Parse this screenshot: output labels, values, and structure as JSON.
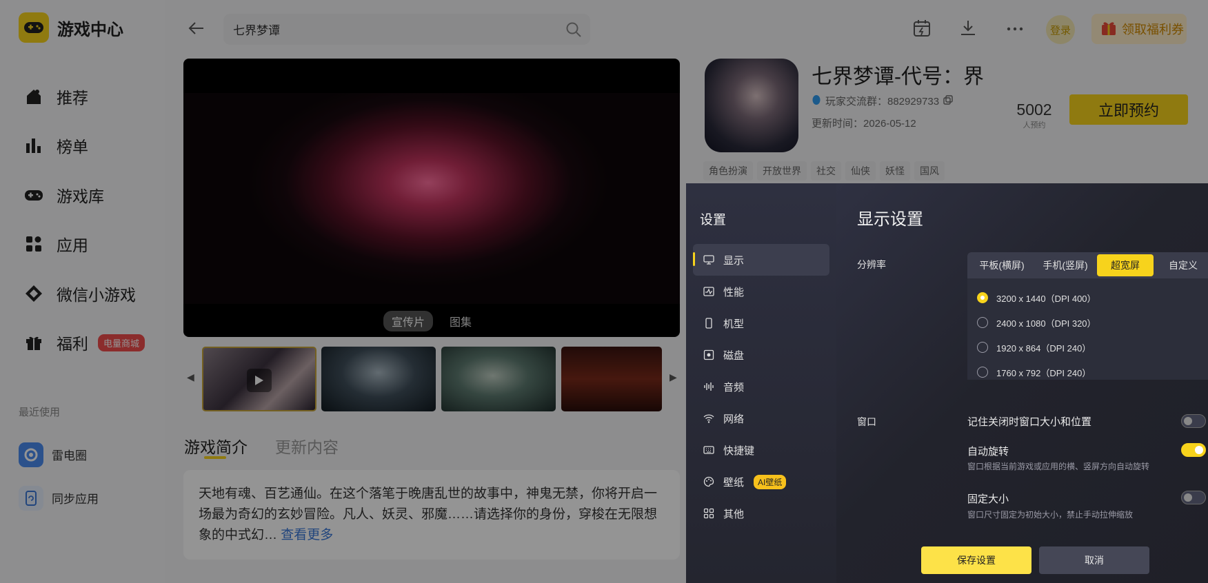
{
  "app": {
    "name": "游戏中心",
    "colors": {
      "accent": "#f7d31c",
      "panel_bg": "#24252f",
      "red_badge": "#f04d4d",
      "link": "#3a78d8"
    }
  },
  "sidebar": {
    "items": [
      {
        "label": "推荐",
        "icon": "house-icon"
      },
      {
        "label": "榜单",
        "icon": "bar-chart-icon"
      },
      {
        "label": "游戏库",
        "icon": "gamepad-icon"
      },
      {
        "label": "应用",
        "icon": "apps-icon"
      },
      {
        "label": "微信小游戏",
        "icon": "diamond-icon"
      },
      {
        "label": "福利",
        "icon": "gift-icon",
        "badge": "电量商城"
      }
    ],
    "recent_title": "最近使用",
    "recent": [
      {
        "label": "雷电圈",
        "icon": "circle-app-icon"
      },
      {
        "label": "同步应用",
        "icon": "sync-app-icon"
      }
    ]
  },
  "topbar": {
    "search_value": "七界梦谭",
    "login": "登录",
    "welfare": "领取福利券"
  },
  "media": {
    "tabs": [
      "宣传片",
      "图集"
    ],
    "active_tab": 0
  },
  "content_tabs": [
    "游戏简介",
    "更新内容"
  ],
  "intro": {
    "text": "天地有魂、百艺通仙。在这个落笔于晚唐乱世的故事中，神鬼无禁，你将开启一场最为奇幻的玄妙冒险。凡人、妖灵、邪魔……请选择你的身份，穿梭在无限想象的中式幻…",
    "more": "查看更多"
  },
  "game": {
    "title": "七界梦谭-代号：界",
    "qq_group": "玩家交流群：882929733",
    "update": "更新时间：2026-05-12",
    "reservations": "5002",
    "reservations_label": "人预约",
    "reserve_button": "立即预约",
    "tags": [
      "角色扮演",
      "开放世界",
      "社交",
      "仙侠",
      "妖怪",
      "国风"
    ]
  },
  "settings": {
    "title": "设置",
    "menu": [
      {
        "label": "显示",
        "icon": "monitor-icon"
      },
      {
        "label": "性能",
        "icon": "performance-icon"
      },
      {
        "label": "机型",
        "icon": "phone-icon"
      },
      {
        "label": "磁盘",
        "icon": "disk-icon"
      },
      {
        "label": "音频",
        "icon": "audio-icon"
      },
      {
        "label": "网络",
        "icon": "wifi-icon"
      },
      {
        "label": "快捷键",
        "icon": "keyboard-icon"
      },
      {
        "label": "壁纸",
        "icon": "palette-icon",
        "badge": "AI壁纸"
      },
      {
        "label": "其他",
        "icon": "grid-icon"
      }
    ],
    "active_menu": 0,
    "display_title": "显示设置",
    "resolution_label": "分辨率",
    "resolution_tabs": [
      "平板(横屏)",
      "手机(竖屏)",
      "超宽屏",
      "自定义"
    ],
    "active_resolution_tab": 2,
    "resolutions": [
      {
        "label": "3200 x 1440（DPI 400）",
        "selected": true
      },
      {
        "label": "2400 x 1080（DPI 320）",
        "selected": false
      },
      {
        "label": "1920 x 864（DPI 240）",
        "selected": false
      },
      {
        "label": "1760 x 792（DPI 240）",
        "selected": false
      }
    ],
    "window_label": "窗口",
    "window_options": [
      {
        "title": "记住关闭时窗口大小和位置",
        "desc": "",
        "on": false
      },
      {
        "title": "自动旋转",
        "desc": "窗口根据当前游戏或应用的横、竖屏方向自动旋转",
        "on": true
      },
      {
        "title": "固定大小",
        "desc": "窗口尺寸固定为初始大小，禁止手动拉伸缩放",
        "on": false
      }
    ],
    "save": "保存设置",
    "cancel": "取消"
  }
}
